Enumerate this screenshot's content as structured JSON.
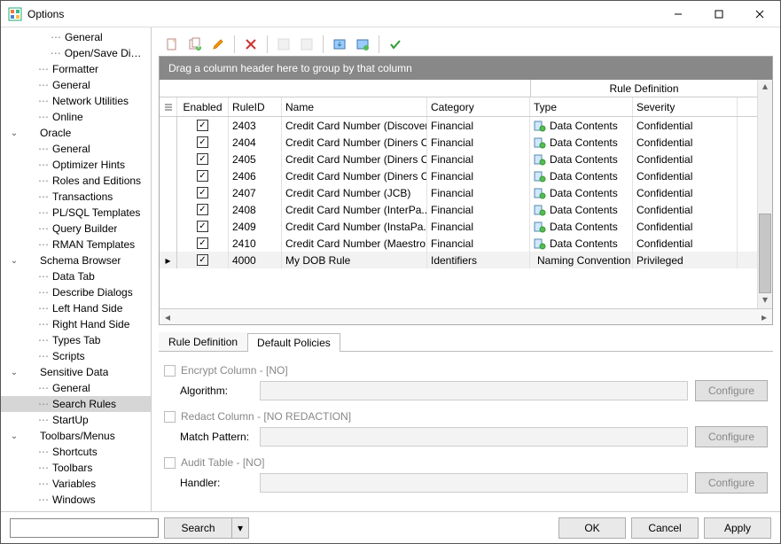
{
  "window": {
    "title": "Options"
  },
  "tree": [
    {
      "lvl": 2,
      "chev": "",
      "dots": "⋯",
      "label": "General"
    },
    {
      "lvl": 2,
      "chev": "",
      "dots": "⋯",
      "label": "Open/Save Dial..."
    },
    {
      "lvl": 1,
      "chev": "",
      "dots": "⋯",
      "label": "Formatter"
    },
    {
      "lvl": 1,
      "chev": "",
      "dots": "⋯",
      "label": "General"
    },
    {
      "lvl": 1,
      "chev": "",
      "dots": "⋯",
      "label": "Network Utilities"
    },
    {
      "lvl": 1,
      "chev": "",
      "dots": "⋯",
      "label": "Online"
    },
    {
      "lvl": 0,
      "chev": "⌄",
      "dots": "",
      "label": "Oracle"
    },
    {
      "lvl": 1,
      "chev": "",
      "dots": "⋯",
      "label": "General"
    },
    {
      "lvl": 1,
      "chev": "",
      "dots": "⋯",
      "label": "Optimizer Hints"
    },
    {
      "lvl": 1,
      "chev": "",
      "dots": "⋯",
      "label": "Roles and Editions"
    },
    {
      "lvl": 1,
      "chev": "",
      "dots": "⋯",
      "label": "Transactions"
    },
    {
      "lvl": 1,
      "chev": "",
      "dots": "⋯",
      "label": "PL/SQL Templates"
    },
    {
      "lvl": 1,
      "chev": "",
      "dots": "⋯",
      "label": "Query Builder"
    },
    {
      "lvl": 1,
      "chev": "",
      "dots": "⋯",
      "label": "RMAN Templates"
    },
    {
      "lvl": 0,
      "chev": "⌄",
      "dots": "",
      "label": "Schema Browser"
    },
    {
      "lvl": 1,
      "chev": "",
      "dots": "⋯",
      "label": "Data Tab"
    },
    {
      "lvl": 1,
      "chev": "",
      "dots": "⋯",
      "label": "Describe Dialogs"
    },
    {
      "lvl": 1,
      "chev": "",
      "dots": "⋯",
      "label": "Left Hand Side"
    },
    {
      "lvl": 1,
      "chev": "",
      "dots": "⋯",
      "label": "Right Hand Side"
    },
    {
      "lvl": 1,
      "chev": "",
      "dots": "⋯",
      "label": "Types Tab"
    },
    {
      "lvl": 1,
      "chev": "",
      "dots": "⋯",
      "label": "Scripts"
    },
    {
      "lvl": 0,
      "chev": "⌄",
      "dots": "",
      "label": "Sensitive Data"
    },
    {
      "lvl": 1,
      "chev": "",
      "dots": "⋯",
      "label": "General"
    },
    {
      "lvl": 1,
      "chev": "",
      "dots": "⋯",
      "label": "Search Rules",
      "selected": true
    },
    {
      "lvl": 1,
      "chev": "",
      "dots": "⋯",
      "label": "StartUp"
    },
    {
      "lvl": 0,
      "chev": "⌄",
      "dots": "",
      "label": "Toolbars/Menus"
    },
    {
      "lvl": 1,
      "chev": "",
      "dots": "⋯",
      "label": "Shortcuts"
    },
    {
      "lvl": 1,
      "chev": "",
      "dots": "⋯",
      "label": "Toolbars"
    },
    {
      "lvl": 1,
      "chev": "",
      "dots": "⋯",
      "label": "Variables"
    },
    {
      "lvl": 1,
      "chev": "",
      "dots": "⋯",
      "label": "Windows"
    }
  ],
  "grid": {
    "group_hint": "Drag a column header here to group by that column",
    "super_header": "Rule Definition",
    "columns": {
      "enabled": "Enabled",
      "ruleid": "RuleID",
      "name": "Name",
      "category": "Category",
      "type": "Type",
      "severity": "Severity"
    },
    "rows": [
      {
        "enabled": true,
        "ruleid": "2403",
        "name": "Credit Card Number (Discover)",
        "category": "Financial",
        "type": "Data Contents",
        "severity": "Confidential",
        "typeicon": "dc"
      },
      {
        "enabled": true,
        "ruleid": "2404",
        "name": "Credit Card Number (Diners C...",
        "category": "Financial",
        "type": "Data Contents",
        "severity": "Confidential",
        "typeicon": "dc"
      },
      {
        "enabled": true,
        "ruleid": "2405",
        "name": "Credit Card Number (Diners C...",
        "category": "Financial",
        "type": "Data Contents",
        "severity": "Confidential",
        "typeicon": "dc"
      },
      {
        "enabled": true,
        "ruleid": "2406",
        "name": "Credit Card Number (Diners C...",
        "category": "Financial",
        "type": "Data Contents",
        "severity": "Confidential",
        "typeicon": "dc"
      },
      {
        "enabled": true,
        "ruleid": "2407",
        "name": "Credit Card Number (JCB)",
        "category": "Financial",
        "type": "Data Contents",
        "severity": "Confidential",
        "typeicon": "dc"
      },
      {
        "enabled": true,
        "ruleid": "2408",
        "name": "Credit Card Number (InterPa...",
        "category": "Financial",
        "type": "Data Contents",
        "severity": "Confidential",
        "typeicon": "dc"
      },
      {
        "enabled": true,
        "ruleid": "2409",
        "name": "Credit Card Number (InstaPa...",
        "category": "Financial",
        "type": "Data Contents",
        "severity": "Confidential",
        "typeicon": "dc"
      },
      {
        "enabled": true,
        "ruleid": "2410",
        "name": "Credit Card Number (Maestro...",
        "category": "Financial",
        "type": "Data Contents",
        "severity": "Confidential",
        "typeicon": "dc"
      },
      {
        "enabled": true,
        "ruleid": "4000",
        "name": "My DOB Rule",
        "category": "Identifiers",
        "type": "Naming Convention",
        "severity": "Privileged",
        "typeicon": "nc",
        "selected": true
      }
    ]
  },
  "tabs": {
    "rule_def": "Rule Definition",
    "default_pol": "Default Policies"
  },
  "policies": {
    "encrypt_label": "Encrypt Column - [NO]",
    "algorithm_label": "Algorithm:",
    "redact_label": "Redact Column - [NO REDACTION]",
    "match_label": "Match Pattern:",
    "audit_label": "Audit Table - [NO]",
    "handler_label": "Handler:",
    "configure": "Configure"
  },
  "buttons": {
    "search": "Search",
    "ok": "OK",
    "cancel": "Cancel",
    "apply": "Apply"
  }
}
